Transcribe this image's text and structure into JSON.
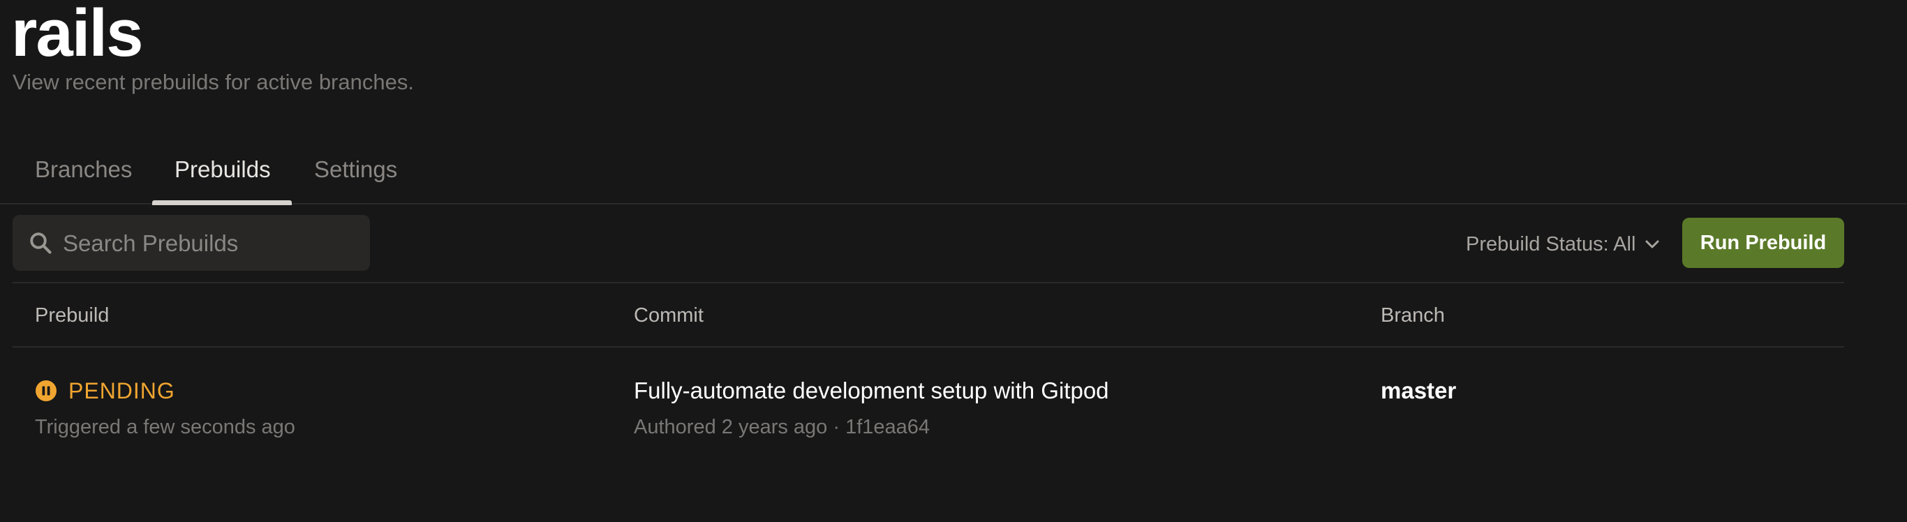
{
  "header": {
    "title": "rails",
    "subtitle": "View recent prebuilds for active branches."
  },
  "tabs": [
    {
      "label": "Branches",
      "active": false
    },
    {
      "label": "Prebuilds",
      "active": true
    },
    {
      "label": "Settings",
      "active": false
    }
  ],
  "toolbar": {
    "search_placeholder": "Search Prebuilds",
    "search_value": "",
    "status_filter_label": "Prebuild Status: All",
    "run_button_label": "Run Prebuild",
    "run_button_color": "#5b7a29"
  },
  "table": {
    "columns": [
      "Prebuild",
      "Commit",
      "Branch"
    ],
    "rows": [
      {
        "status": "PENDING",
        "status_icon": "pause-circle-icon",
        "status_color": "#f0a530",
        "triggered": "Triggered a few seconds ago",
        "commit_message": "Fully-automate development setup with Gitpod",
        "commit_meta": "Authored 2 years ago · 1f1eaa64",
        "branch": "master"
      }
    ]
  }
}
